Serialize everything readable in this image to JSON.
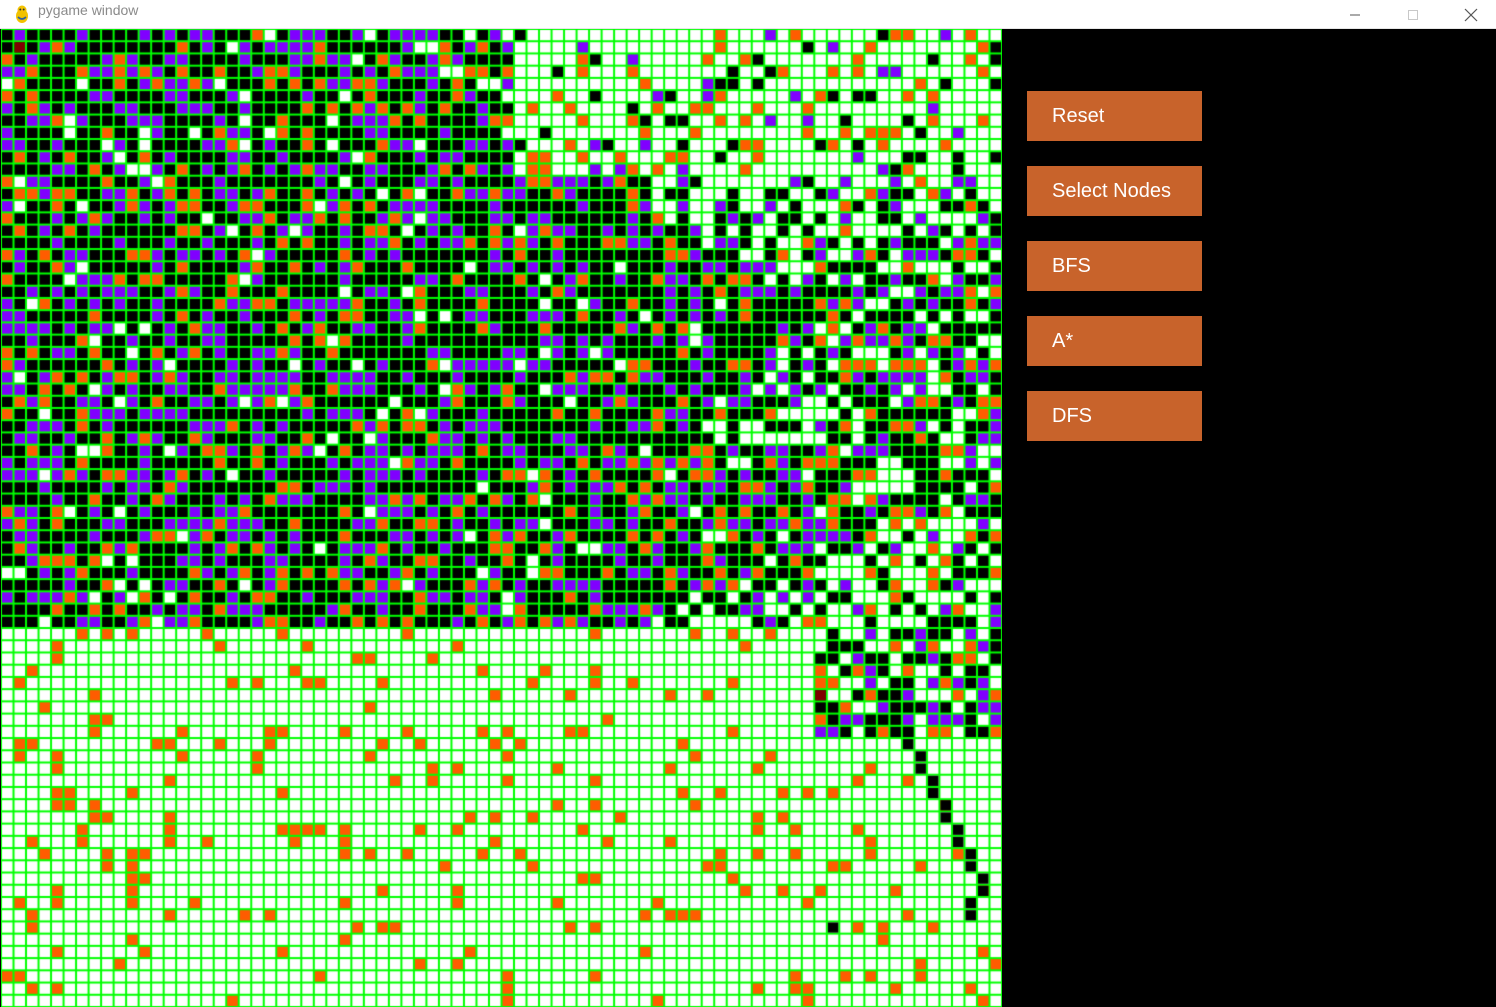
{
  "window": {
    "title": "pygame window",
    "app_icon": "pygame-snake-icon",
    "controls": {
      "minimize_icon": "minimize-icon",
      "maximize_icon": "maximize-icon",
      "close_icon": "close-icon"
    }
  },
  "grid": {
    "rows": 80,
    "cols": 80,
    "colors": {
      "empty": "#ffffff",
      "barrier": "#ff5c00",
      "visited": "#000000",
      "frontier": "#8000ff",
      "path": "#000000",
      "start": "#ff0000",
      "end": "#800000",
      "gridline": "#00ff00"
    }
  },
  "buttons": [
    {
      "id": "reset",
      "label": "Reset"
    },
    {
      "id": "select-nodes",
      "label": "Select Nodes"
    },
    {
      "id": "bfs",
      "label": "BFS"
    },
    {
      "id": "astar",
      "label": "A*"
    },
    {
      "id": "dfs",
      "label": "DFS"
    }
  ],
  "theme": {
    "button_bg": "#c8632b",
    "button_text": "#ffffff",
    "sidebar_bg": "#000000"
  }
}
